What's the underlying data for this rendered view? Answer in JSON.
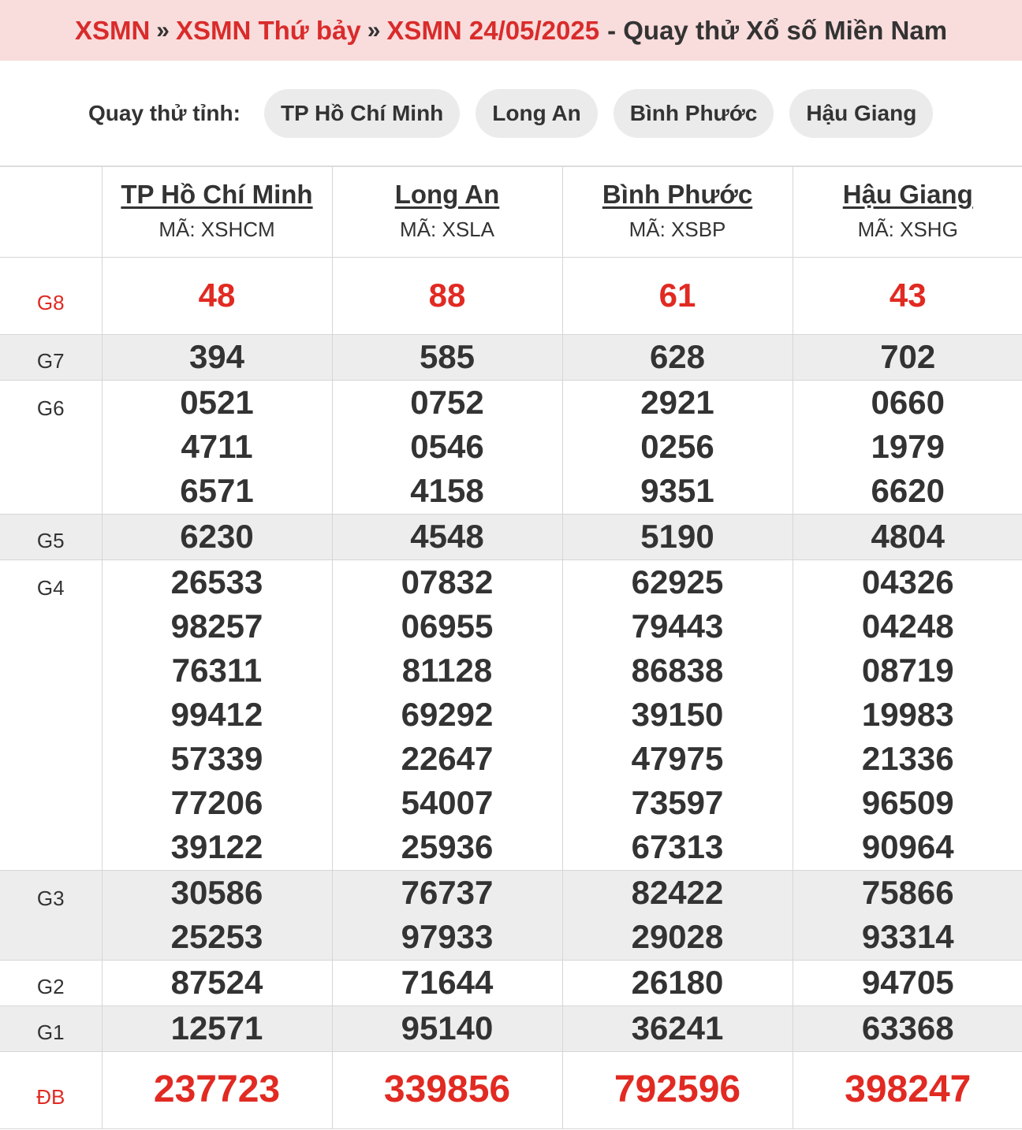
{
  "header": {
    "crumbs": [
      "XSMN",
      "XSMN Thứ bảy",
      "XSMN 24/05/2025"
    ],
    "separator": "»",
    "title_rest": "- Quay thử Xổ số Miền Nam"
  },
  "province_bar": {
    "label": "Quay thử tỉnh:",
    "pills": [
      "TP Hồ Chí Minh",
      "Long An",
      "Bình Phước",
      "Hậu Giang"
    ]
  },
  "provinces": [
    {
      "name": "TP Hồ Chí Minh",
      "code": "MÃ: XSHCM"
    },
    {
      "name": "Long An",
      "code": "MÃ: XSLA"
    },
    {
      "name": "Bình Phước",
      "code": "MÃ: XSBP"
    },
    {
      "name": "Hậu Giang",
      "code": "MÃ: XSHG"
    }
  ],
  "prizes": [
    {
      "label": "G8",
      "cls": "r-g8",
      "style": "red",
      "values": [
        [
          "48"
        ],
        [
          "88"
        ],
        [
          "61"
        ],
        [
          "43"
        ]
      ]
    },
    {
      "label": "G7",
      "cls": "r-g7 alt small",
      "style": "",
      "values": [
        [
          "394"
        ],
        [
          "585"
        ],
        [
          "628"
        ],
        [
          "702"
        ]
      ]
    },
    {
      "label": "G6",
      "cls": "r-g6 multi",
      "style": "",
      "values": [
        [
          "0521",
          "4711",
          "6571"
        ],
        [
          "0752",
          "0546",
          "4158"
        ],
        [
          "2921",
          "0256",
          "9351"
        ],
        [
          "0660",
          "1979",
          "6620"
        ]
      ]
    },
    {
      "label": "G5",
      "cls": "r-g5 alt small",
      "style": "",
      "values": [
        [
          "6230"
        ],
        [
          "4548"
        ],
        [
          "5190"
        ],
        [
          "4804"
        ]
      ]
    },
    {
      "label": "G4",
      "cls": "r-g4 multi",
      "style": "",
      "values": [
        [
          "26533",
          "98257",
          "76311",
          "99412",
          "57339",
          "77206",
          "39122"
        ],
        [
          "07832",
          "06955",
          "81128",
          "69292",
          "22647",
          "54007",
          "25936"
        ],
        [
          "62925",
          "79443",
          "86838",
          "39150",
          "47975",
          "73597",
          "67313"
        ],
        [
          "04326",
          "04248",
          "08719",
          "19983",
          "21336",
          "96509",
          "90964"
        ]
      ]
    },
    {
      "label": "G3",
      "cls": "r-g3 alt multi",
      "style": "",
      "values": [
        [
          "30586",
          "25253"
        ],
        [
          "76737",
          "97933"
        ],
        [
          "82422",
          "29028"
        ],
        [
          "75866",
          "93314"
        ]
      ]
    },
    {
      "label": "G2",
      "cls": "r-g2 small",
      "style": "",
      "values": [
        [
          "87524"
        ],
        [
          "71644"
        ],
        [
          "26180"
        ],
        [
          "94705"
        ]
      ]
    },
    {
      "label": "G1",
      "cls": "r-g1 alt small",
      "style": "",
      "values": [
        [
          "12571"
        ],
        [
          "95140"
        ],
        [
          "36241"
        ],
        [
          "63368"
        ]
      ]
    },
    {
      "label": "ĐB",
      "cls": "r-db",
      "style": "red big",
      "values": [
        [
          "237723"
        ],
        [
          "339856"
        ],
        [
          "792596"
        ],
        [
          "398247"
        ]
      ]
    }
  ],
  "colors": {
    "accent": "#d92b2b",
    "prize_red": "#e12a22",
    "header_bg": "#f9dcdc",
    "alt_row": "#ededed"
  }
}
